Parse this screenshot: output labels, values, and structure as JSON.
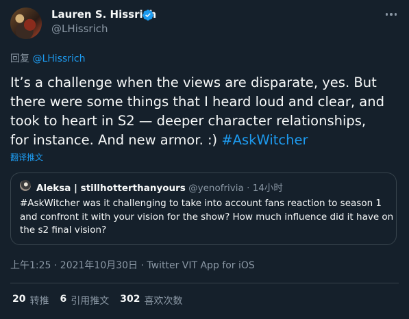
{
  "author": {
    "name": "Lauren S. Hissrich",
    "handle": "@LHissrich"
  },
  "reply": {
    "prefix": "回复",
    "mention": "@LHissrich"
  },
  "tweet": {
    "line1": "It’s a challenge when the views are disparate, yes. But",
    "line2": "there were some things that I heard loud and clear, and",
    "line3": "took to heart in S2 — deeper character relationships,",
    "line4_text": "for instance. And new armor. :) ",
    "hashtag": "#AskWitcher",
    "translate": "翻译推文"
  },
  "quote": {
    "name": "Aleksa | stillhotterthanyours",
    "handle": "@yenofrivia",
    "separator": "·",
    "time": "14小时",
    "line1": "#AskWitcher was it challenging to take into account fans reaction to season 1",
    "line2": "and confront it with your vision for the show? How much influence did it have on",
    "line3": "the s2 final vision?"
  },
  "meta": {
    "text": "上午1:25 · 2021年10月30日 · Twitter VIT App for iOS"
  },
  "stats": {
    "retweets_count": "20",
    "retweets_label": "转推",
    "quotes_count": "6",
    "quotes_label": "引用推文",
    "likes_count": "302",
    "likes_label": "喜欢次数"
  },
  "colors": {
    "background": "#15202b",
    "accent": "#1d9bf0",
    "secondary_text": "#8b98a5",
    "border": "#38444d"
  }
}
